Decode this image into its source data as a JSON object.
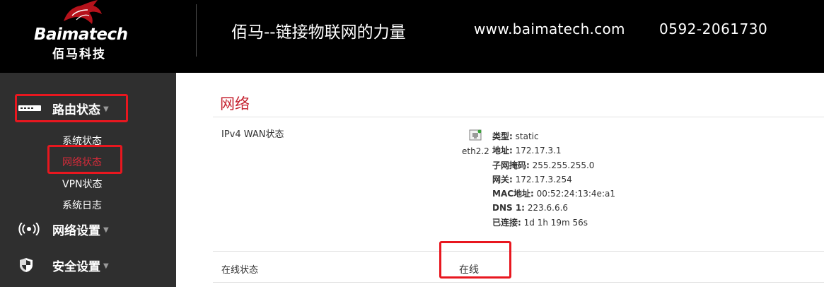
{
  "header": {
    "logo_en": "Baimatech",
    "logo_cn": "佰马科技",
    "slogan": "佰马--链接物联网的力量",
    "website": "www.baimatech.com",
    "phone": "0592-2061730",
    "background": "#000000"
  },
  "sidebar": {
    "background": "#2f2f2f",
    "menus": [
      {
        "label": "路由状态",
        "icon": "router-icon",
        "highlighted": true,
        "items": [
          {
            "label": "系统状态",
            "active": false
          },
          {
            "label": "网络状态",
            "active": true,
            "highlighted": true
          },
          {
            "label": "VPN状态",
            "active": false
          },
          {
            "label": "系统日志",
            "active": false
          }
        ]
      },
      {
        "label": "网络设置",
        "icon": "wireless-icon"
      },
      {
        "label": "安全设置",
        "icon": "shield-icon"
      }
    ],
    "active_color": "#d62b3a"
  },
  "main": {
    "title": "网络",
    "accent_color": "#c5222f",
    "wan": {
      "label": "IPv4 WAN状态",
      "interface": "eth2.2",
      "fields": [
        {
          "key": "类型:",
          "value": "static"
        },
        {
          "key": "地址:",
          "value": "172.17.3.1"
        },
        {
          "key": "子网掩码:",
          "value": "255.255.255.0"
        },
        {
          "key": "网关:",
          "value": "172.17.3.254"
        },
        {
          "key": "MAC地址:",
          "value": "00:52:24:13:4e:a1"
        },
        {
          "key": "DNS 1:",
          "value": "223.6.6.6"
        },
        {
          "key": "已连接:",
          "value": "1d 1h 19m 56s"
        }
      ]
    },
    "online": {
      "label": "在线状态",
      "value": "在线",
      "highlighted": true
    }
  },
  "highlight_color": "#e8171f"
}
